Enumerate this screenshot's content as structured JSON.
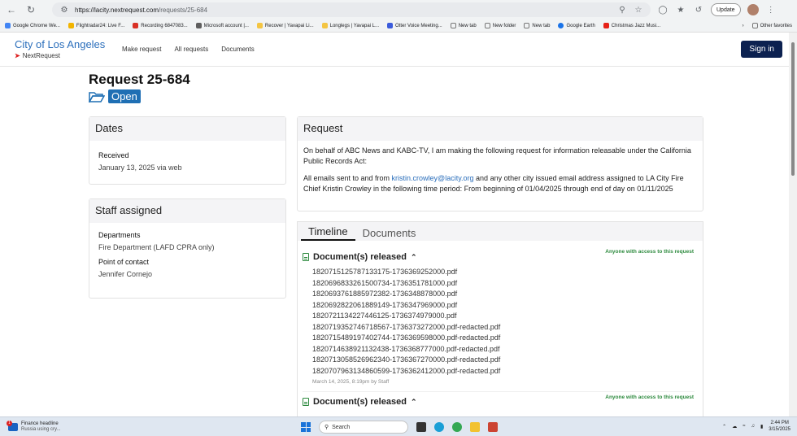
{
  "browser": {
    "url_host": "https://lacity.nextrequest.com",
    "url_path": "/requests/25-684",
    "update_label": "Update",
    "bookmarks": [
      {
        "label": "Google Chrome We...",
        "color": "#4285f4"
      },
      {
        "label": "Flightradar24: Live F...",
        "color": "#f2b400"
      },
      {
        "label": "Recording 6847083...",
        "color": "#d93025"
      },
      {
        "label": "Microsoft account |...",
        "color": "#5e5e5e"
      },
      {
        "label": "Recover | Yavapai Li...",
        "color": "#f4c542"
      },
      {
        "label": "Longlegs | Yavapai L...",
        "color": "#f4c542"
      },
      {
        "label": "Otter Voice Meeting...",
        "color": "#3b5bdb"
      },
      {
        "label": "New tab",
        "color": "#777"
      },
      {
        "label": "New folder",
        "color": "#777"
      },
      {
        "label": "New tab",
        "color": "#777"
      },
      {
        "label": "Google Earth",
        "color": "#1a73e8"
      },
      {
        "label": "Christmas Jazz Musi...",
        "color": "#e62117"
      }
    ],
    "other_favorites": "Other favorites"
  },
  "site": {
    "brand_title": "City of Los Angeles",
    "brand_sub": "NextRequest",
    "nav": [
      "Make request",
      "All requests",
      "Documents"
    ],
    "signin_label": "Sign in"
  },
  "request": {
    "title": "Request 25-684",
    "status": "Open"
  },
  "dates": {
    "heading": "Dates",
    "received_label": "Received",
    "received_value": "January 13, 2025 via web"
  },
  "staff": {
    "heading": "Staff assigned",
    "departments_label": "Departments",
    "departments_value": "Fire Department (LAFD CPRA only)",
    "poc_label": "Point of contact",
    "poc_value": "Jennifer Cornejo"
  },
  "request_card": {
    "heading": "Request",
    "para1": "On behalf of ABC News and KABC-TV, I am making the following request for information releasable under the California Public Records Act:",
    "para2_prefix": "All emails sent to and from ",
    "para2_email": "kristin.crowley@lacity.org",
    "para2_suffix": " and any other city issued email address assigned to LA City Fire Chief Kristin Crowley in the following time period: From beginning of 01/04/2025 through end of day on 01/11/2025"
  },
  "timeline": {
    "tabs": [
      "Timeline",
      "Documents"
    ],
    "events": [
      {
        "title": "Document(s) released",
        "access": "Anyone with access to this request",
        "files": [
          "1820715125787133175-1736369252000.pdf",
          "1820696833261500734-1736351781000.pdf",
          "1820693761885972382-1736348878000.pdf",
          "1820692822061889149-1736347969000.pdf",
          "1820721134227446125-1736374979000.pdf",
          "1820719352746718567-1736373272000.pdf-redacted.pdf",
          "1820715489197402744-1736369598000.pdf-redacted.pdf",
          "1820714638921132438-1736368777000.pdf-redacted.pdf",
          "1820713058526962340-1736367270000.pdf-redacted.pdf",
          "1820707963134860599-1736362412000.pdf-redacted.pdf"
        ],
        "meta": "March 14, 2025, 8:19pm by Staff"
      },
      {
        "title": "Document(s) released",
        "access": "Anyone with access to this request"
      }
    ]
  },
  "taskbar": {
    "news_title": "Finance headline",
    "news_sub": "Russia using cry...",
    "news_count": "1",
    "search_placeholder": "Search",
    "time": "2:44 PM",
    "date": "3/15/2025"
  }
}
